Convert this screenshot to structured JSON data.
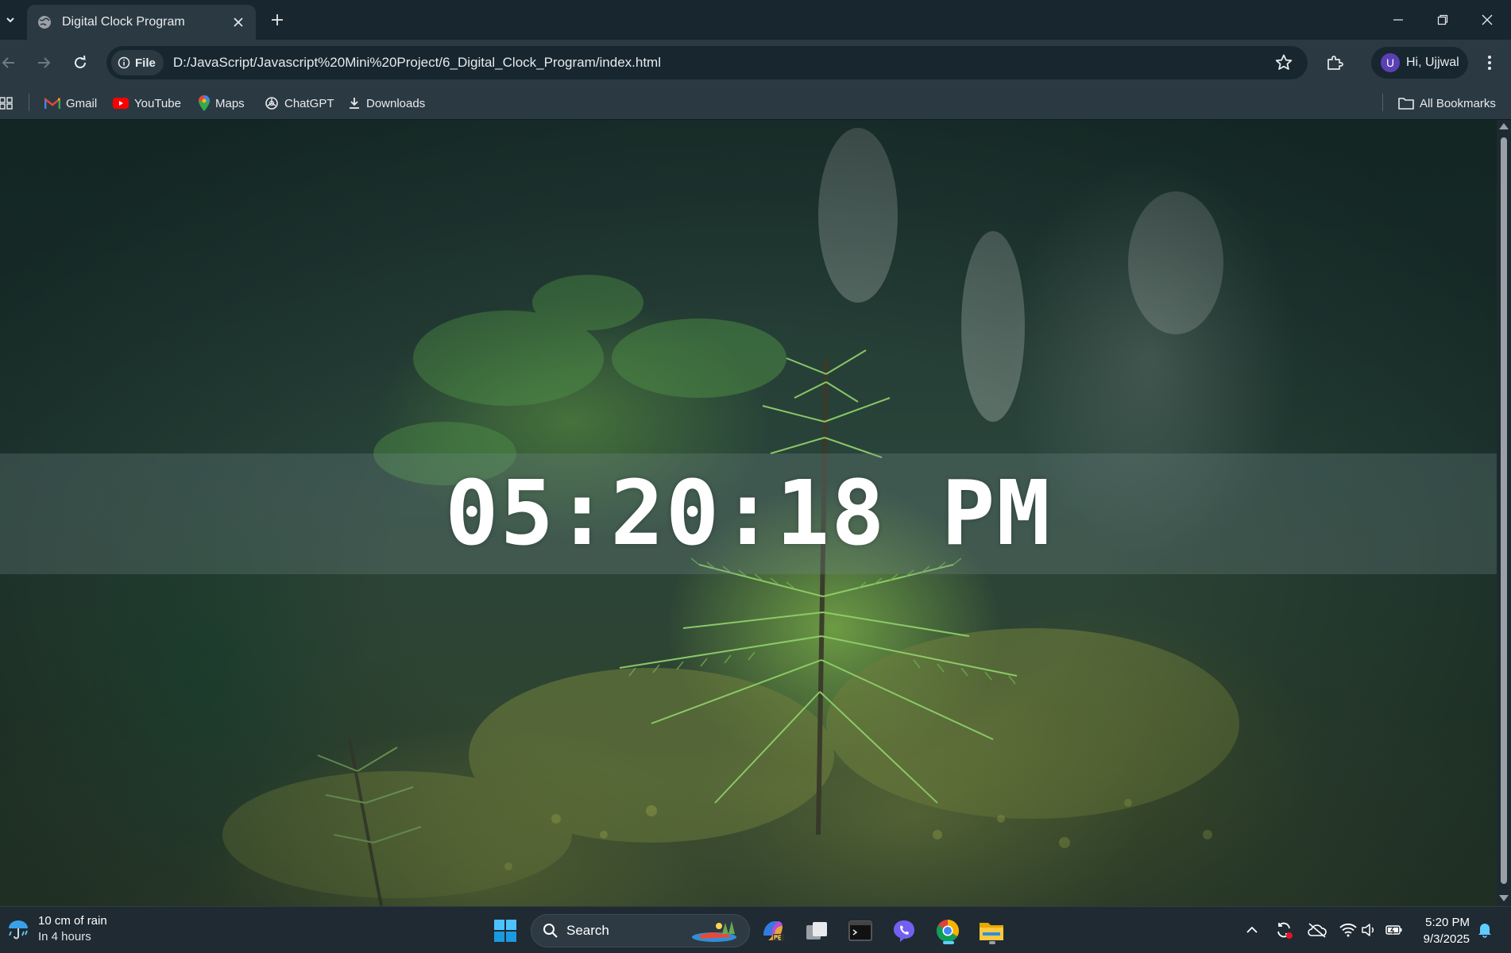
{
  "browser": {
    "tab": {
      "title": "Digital Clock Program"
    },
    "omnibox": {
      "scheme_chip": "File",
      "url": "D:/JavaScript/Javascript%20Mini%20Project/6_Digital_Clock_Program/index.html"
    },
    "profile": {
      "initial": "U",
      "label": "Hi, Ujjwal"
    },
    "bookmarks": {
      "items": [
        {
          "label": "Gmail",
          "icon": "gmail-icon"
        },
        {
          "label": "YouTube",
          "icon": "youtube-icon"
        },
        {
          "label": "Maps",
          "icon": "maps-icon"
        },
        {
          "label": "ChatGPT",
          "icon": "chatgpt-icon"
        },
        {
          "label": "Downloads",
          "icon": "download-icon"
        }
      ],
      "all_bookmarks": "All Bookmarks"
    }
  },
  "page": {
    "clock": "05:20:18 PM"
  },
  "taskbar": {
    "weather": {
      "line1": "10 cm of rain",
      "line2": "In 4 hours"
    },
    "search_placeholder": "Search",
    "time": "5:20 PM",
    "date": "9/3/2025"
  },
  "colors": {
    "titlebar": "#17262f",
    "toolbar": "#2b3a42",
    "taskbar": "#1f2a33",
    "accent": "#60cdff"
  }
}
